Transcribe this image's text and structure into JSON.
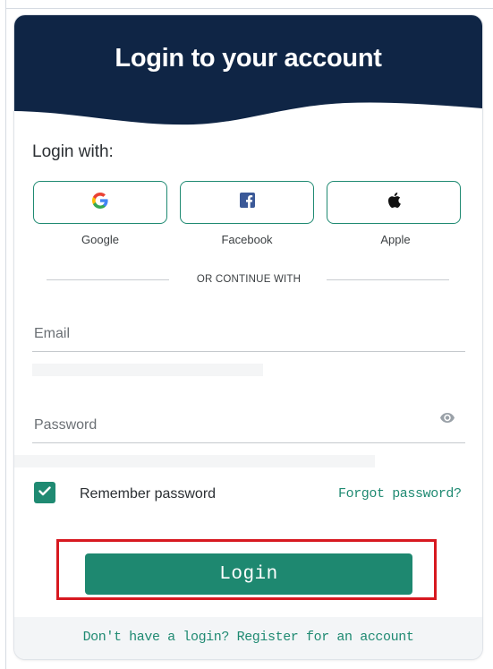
{
  "header": {
    "title": "Login to your account"
  },
  "login_with_label": "Login with:",
  "social": [
    {
      "label": "Google",
      "icon": "google-icon"
    },
    {
      "label": "Facebook",
      "icon": "facebook-icon"
    },
    {
      "label": "Apple",
      "icon": "apple-icon"
    }
  ],
  "divider_text": "OR CONTINUE WITH",
  "email": {
    "placeholder": "Email",
    "value": ""
  },
  "password": {
    "placeholder": "Password",
    "value": "",
    "toggle_icon": "eye-icon"
  },
  "remember": {
    "label": "Remember password",
    "checked": true
  },
  "forgot_link": "Forgot password?",
  "login_button": "Login",
  "footer_link": "Don't have a login? Register for an account",
  "colors": {
    "header_bg": "#0f2545",
    "accent": "#1f8a72",
    "highlight": "#d71920",
    "facebook": "#1877f2"
  }
}
